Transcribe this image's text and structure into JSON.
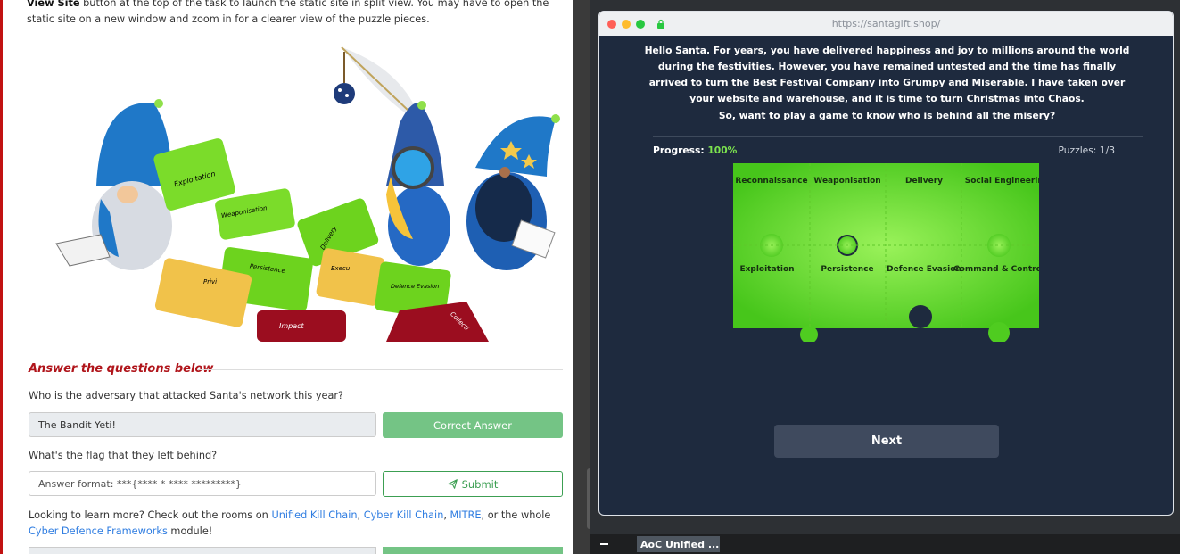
{
  "left": {
    "intro_bold": "View Site",
    "intro_text": " button at the top of the task to launch the static site in split view. You may have to open the static site on a new window and zoom in for a clearer view of the puzzle pieces.",
    "illustration_pieces": [
      "Exploitation",
      "Weaponisation",
      "Delivery",
      "Persistence",
      "Defence Evasion",
      "Privi",
      "Impact",
      "Collecti",
      "Execu"
    ],
    "answer_title": "Answer the questions below",
    "q1": "Who is the adversary that attacked Santa's network this year?",
    "q1_answer": "The Bandit Yeti!",
    "q1_button": "Correct Answer",
    "q2": "What's the flag that they left behind?",
    "q2_placeholder": "Answer format: ***{**** * **** *********}",
    "q2_button": "Submit",
    "more_prefix": "Looking to learn more? Check out the rooms on ",
    "link_ukc": "Unified Kill Chain",
    "sep1": ", ",
    "link_ckc": "Cyber Kill Chain",
    "sep2": ", ",
    "link_mitre": "MITRE",
    "more_mid": ", or the whole ",
    "link_cdf": "Cyber Defence Frameworks",
    "more_suffix": " module!"
  },
  "browser": {
    "url": "https://santagift.shop/",
    "dot_colors": [
      "#ff5f57",
      "#febc2e",
      "#28c840"
    ],
    "message": "Hello Santa. For years, you have delivered happiness and joy to millions around the world during the festivities. However, you have remained untested and the time has finally arrived to turn the Best Festival Company into Grumpy and Miserable. I have taken over your website and warehouse, and it is time to turn Christmas into Chaos.",
    "question": "So, want to play a game to know who is behind all the misery?",
    "progress_label": "Progress: ",
    "progress_value": "100%",
    "puzzles": "Puzzles: 1/3",
    "pieces_top": [
      "Reconnaissance",
      "Weaponisation",
      "Delivery",
      "Social Engineering"
    ],
    "pieces_bottom": [
      "Exploitation",
      "Persistence",
      "Defence Evasion",
      "Command & Control"
    ],
    "next": "Next"
  },
  "taskbar": {
    "item": "AoC Unified ..."
  },
  "colors": {
    "accent_red": "#b0151b",
    "success_green": "#74c485",
    "link_blue": "#2f7de1",
    "puzzle_green": "#7ce34e",
    "page_dark": "#1e2a3e"
  }
}
